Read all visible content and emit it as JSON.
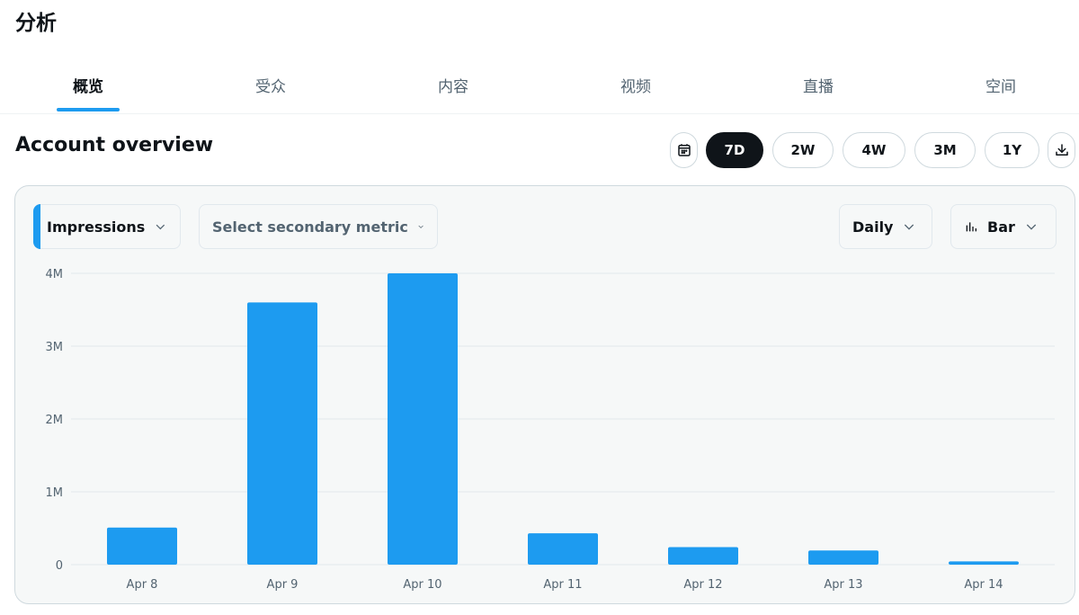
{
  "page": {
    "title": "分析"
  },
  "tabs": [
    {
      "label": "概览",
      "active": true
    },
    {
      "label": "受众",
      "active": false
    },
    {
      "label": "内容",
      "active": false
    },
    {
      "label": "视频",
      "active": false
    },
    {
      "label": "直播",
      "active": false
    },
    {
      "label": "空间",
      "active": false
    }
  ],
  "overview": {
    "title": "Account overview",
    "ranges": [
      {
        "label": "7D",
        "active": true
      },
      {
        "label": "2W",
        "active": false
      },
      {
        "label": "4W",
        "active": false
      },
      {
        "label": "3M",
        "active": false
      },
      {
        "label": "1Y",
        "active": false
      }
    ],
    "calendar_icon": "calendar-icon",
    "download_icon": "download-icon"
  },
  "controls": {
    "primary_metric": "Impressions",
    "secondary_metric": "Select secondary metric",
    "interval": "Daily",
    "chart_type": "Bar",
    "chart_type_icon": "bar-chart-icon"
  },
  "colors": {
    "accent": "#1d9bf0",
    "text": "#0f1419",
    "muted": "#536471",
    "card_bg": "#f6f8f8",
    "border": "#cfd9de"
  },
  "chart_data": {
    "type": "bar",
    "categories": [
      "Apr 8",
      "Apr 9",
      "Apr 10",
      "Apr 11",
      "Apr 12",
      "Apr 13",
      "Apr 14"
    ],
    "values": [
      510000,
      3600000,
      4000000,
      430000,
      240000,
      195000,
      45000
    ],
    "ylim": [
      0,
      4000000
    ],
    "yticks": [
      0,
      1000000,
      2000000,
      3000000,
      4000000
    ],
    "ytick_labels": [
      "0",
      "1M",
      "2M",
      "3M",
      "4M"
    ],
    "grid": true
  }
}
